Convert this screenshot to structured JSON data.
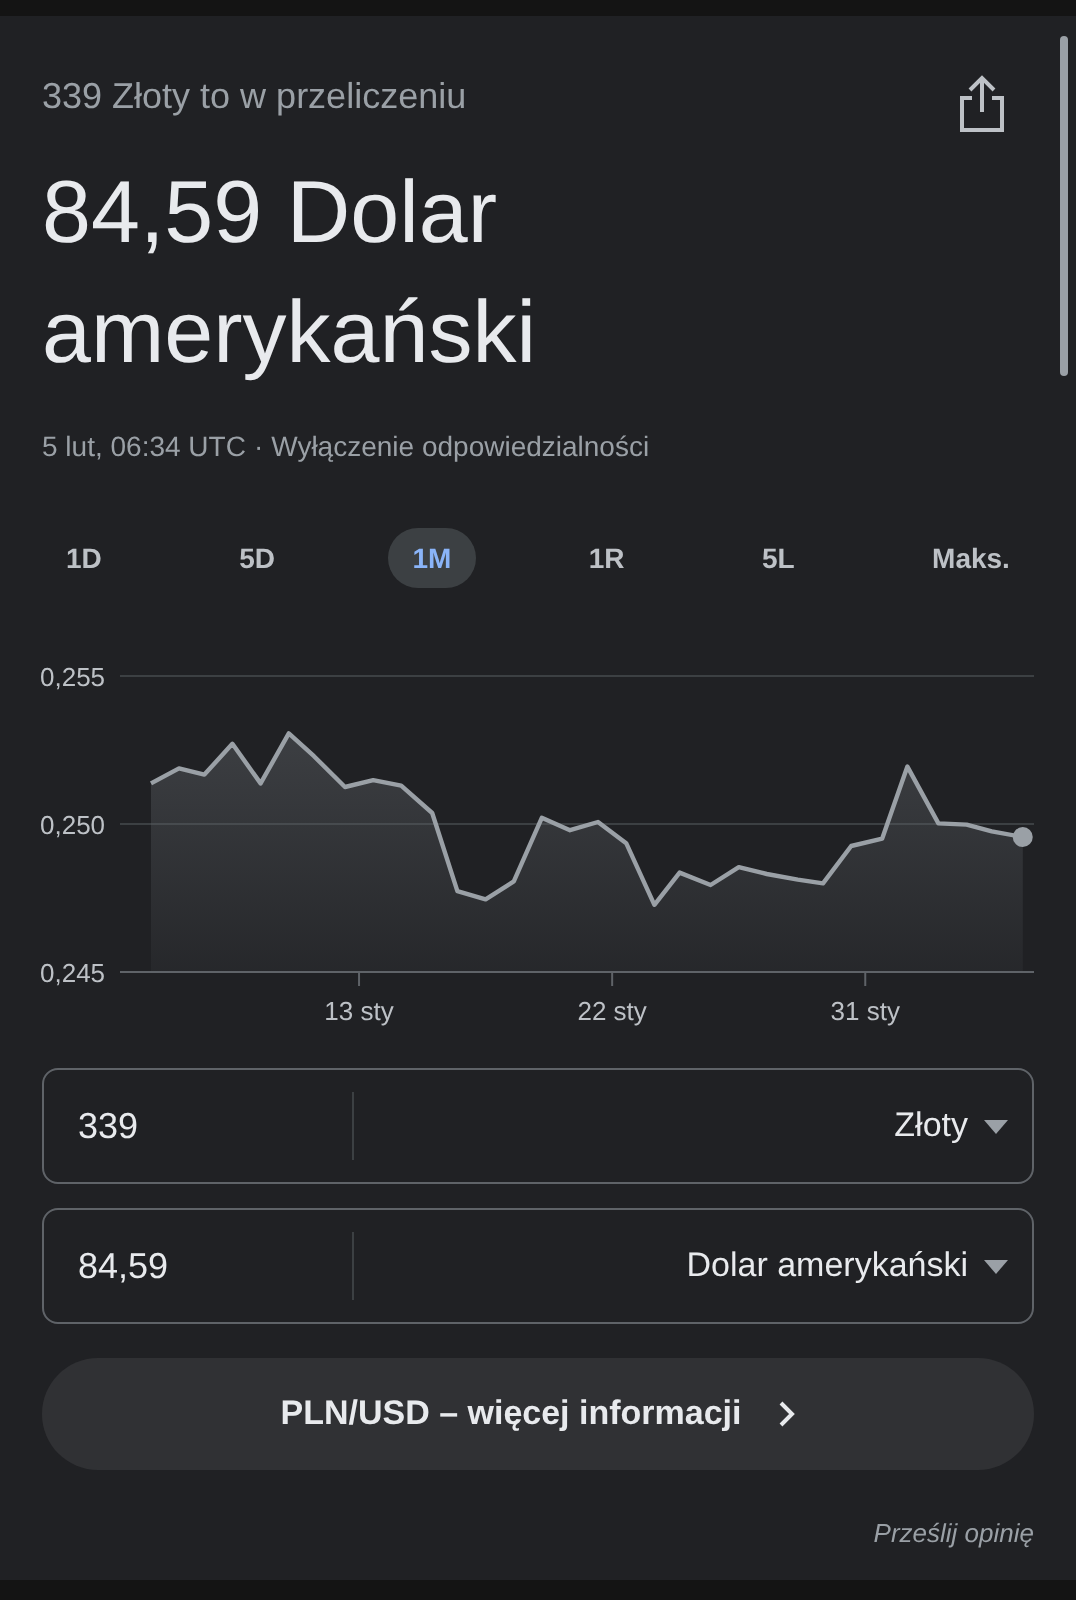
{
  "header": {
    "subtitle": "339 Złoty to w przeliczeniu",
    "result": "84,59 Dolar amerykański",
    "timestamp": "5 lut, 06:34 UTC",
    "separator": "·",
    "disclaimer_link": "Wyłączenie odpowiedzialności"
  },
  "range_tabs": [
    {
      "label": "1D",
      "selected": false
    },
    {
      "label": "5D",
      "selected": false
    },
    {
      "label": "1M",
      "selected": true
    },
    {
      "label": "1R",
      "selected": false
    },
    {
      "label": "5L",
      "selected": false
    },
    {
      "label": "Maks.",
      "selected": false
    }
  ],
  "chart": {
    "chart_data": {
      "type": "area",
      "x": [
        5.6,
        6.6,
        7.5,
        8.5,
        9.5,
        10.5,
        11.4,
        12.5,
        13.5,
        14.5,
        15.6,
        16.5,
        17.5,
        18.5,
        19.5,
        20.5,
        21.5,
        22.5,
        23.5,
        24.4,
        25.5,
        26.5,
        27.5,
        28.6,
        29.5,
        30.5,
        31.6,
        32.5,
        33.6,
        34.6,
        35.5,
        36.6
      ],
      "series": [
        {
          "color": "#9aa0a6",
          "values": [
            0.25137,
            0.25188,
            0.25167,
            0.25271,
            0.25137,
            0.25306,
            0.25229,
            0.25125,
            0.25148,
            0.2513,
            0.25037,
            0.24773,
            0.24745,
            0.24806,
            0.25021,
            0.24979,
            0.25007,
            0.24935,
            0.24727,
            0.24836,
            0.24794,
            0.24854,
            0.24831,
            0.24812,
            0.24799,
            0.24926,
            0.24951,
            0.25194,
            0.25002,
            0.24998,
            0.24975,
            0.24956
          ]
        }
      ],
      "xlim": [
        4.5,
        37
      ],
      "ylim": [
        0.245,
        0.255
      ],
      "xticks": [
        {
          "value": 13,
          "label": "13 sty"
        },
        {
          "value": 22,
          "label": "22 sty"
        },
        {
          "value": 31,
          "label": "31 sty"
        }
      ],
      "yticks": [
        {
          "value": 0.255,
          "label": "0,255"
        },
        {
          "value": 0.25,
          "label": "0,250"
        },
        {
          "value": 0.245,
          "label": "0,245"
        }
      ]
    }
  },
  "converter": [
    {
      "amount": "339",
      "currency": "Złoty"
    },
    {
      "amount": "84,59",
      "currency": "Dolar amerykański"
    }
  ],
  "more_info_button": {
    "label": "PLN/USD – więcej informacji"
  },
  "feedback_link": "Prześlij opinię"
}
